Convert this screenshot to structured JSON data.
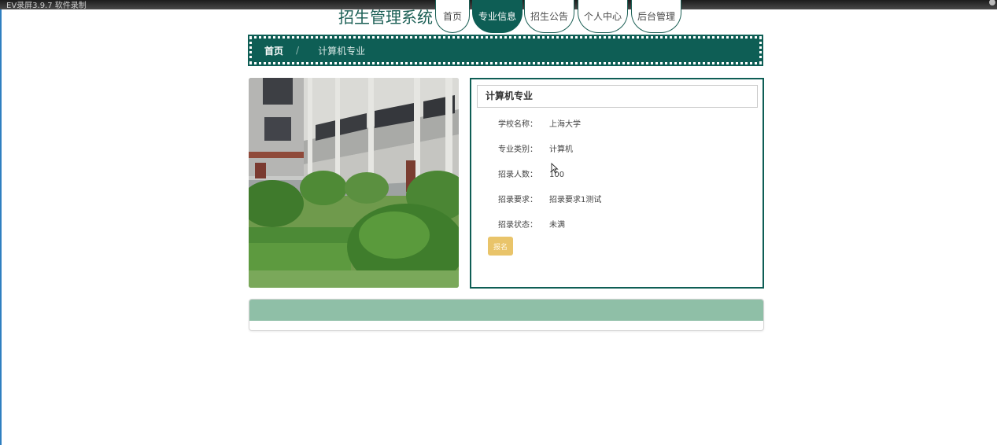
{
  "recorder": {
    "title": "EV录屏3.9.7 软件录制"
  },
  "header": {
    "site_title": "招生管理系统",
    "nav": [
      {
        "label": "首页",
        "active": false
      },
      {
        "label": "专业信息",
        "active": true
      },
      {
        "label": "招生公告",
        "active": false
      },
      {
        "label": "个人中心",
        "active": false
      },
      {
        "label": "后台管理",
        "active": false
      }
    ]
  },
  "breadcrumb": {
    "home": "首页",
    "separator": "/",
    "current": "计算机专业"
  },
  "detail": {
    "title": "计算机专业",
    "fields": [
      {
        "label": "学校名称：",
        "value": "上海大学"
      },
      {
        "label": "专业类别：",
        "value": "计算机"
      },
      {
        "label": "招录人数：",
        "value": "100"
      },
      {
        "label": "招录要求：",
        "value": "招录要求1测试"
      },
      {
        "label": "招录状态：",
        "value": "未满"
      }
    ],
    "button": "报名"
  },
  "colors": {
    "primary": "#0e5e55",
    "button": "#e9c46a",
    "panel_header": "#8fbfa7"
  },
  "icons": {
    "cursor": "mouse-pointer-icon"
  }
}
